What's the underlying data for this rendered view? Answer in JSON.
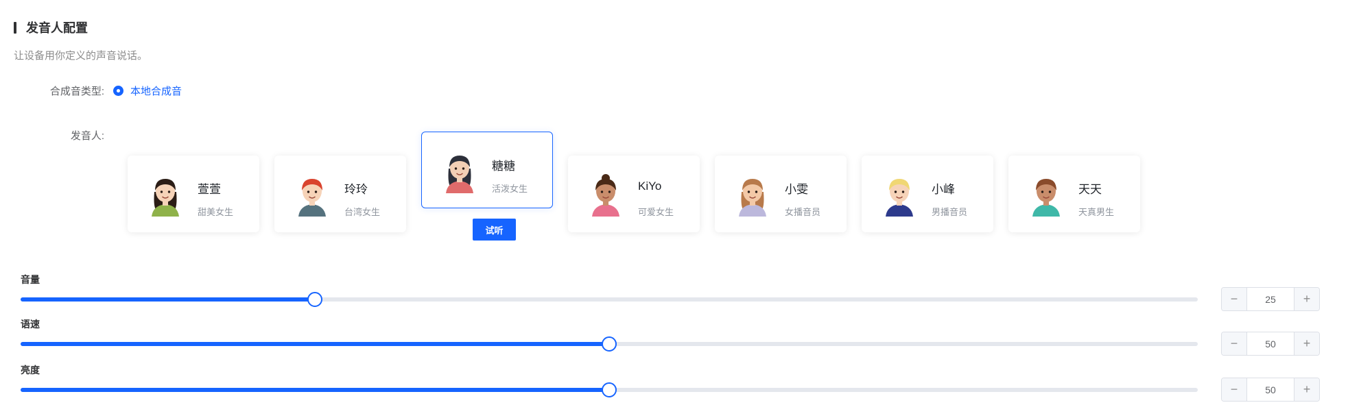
{
  "section": {
    "title": "发音人配置",
    "description": "让设备用你定义的声音说话。"
  },
  "synthesis_type": {
    "label": "合成音类型:",
    "selected_option": "本地合成音"
  },
  "speaker": {
    "label": "发音人:",
    "selected_index": 2,
    "try_button_label": "试听",
    "options": [
      {
        "name": "萱萱",
        "description": "甜美女生",
        "avatar": "avatar-girl-braid",
        "hair_color": "#2b1d16",
        "skin_color": "#f6d3b8",
        "shirt_color": "#8fb24a"
      },
      {
        "name": "玲玲",
        "description": "台湾女生",
        "avatar": "avatar-girl-red-hair",
        "hair_color": "#d9432e",
        "skin_color": "#f6d3b8",
        "shirt_color": "#55727e"
      },
      {
        "name": "糖糖",
        "description": "活泼女生",
        "avatar": "avatar-girl-long-hair",
        "hair_color": "#2c2f3a",
        "skin_color": "#f3cfb5",
        "shirt_color": "#e06b6b"
      },
      {
        "name": "KiYo",
        "description": "可爱女生",
        "avatar": "avatar-girl-bun",
        "hair_color": "#4a2a17",
        "skin_color": "#c98d6b",
        "shirt_color": "#e8708d"
      },
      {
        "name": "小雯",
        "description": "女播音员",
        "avatar": "avatar-girl-headband",
        "hair_color": "#b87a4b",
        "skin_color": "#f3c9a7",
        "shirt_color": "#bcb8dc"
      },
      {
        "name": "小峰",
        "description": "男播音员",
        "avatar": "avatar-boy-blond",
        "hair_color": "#f0d774",
        "skin_color": "#f6d3b8",
        "shirt_color": "#2d3a8c"
      },
      {
        "name": "天天",
        "description": "天真男生",
        "avatar": "avatar-boy-brown",
        "hair_color": "#8a4b2b",
        "skin_color": "#c98d6b",
        "shirt_color": "#3fb8a8"
      }
    ]
  },
  "sliders": [
    {
      "label": "音量",
      "value": "25",
      "fraction": 0.25
    },
    {
      "label": "语速",
      "value": "50",
      "fraction": 0.5
    },
    {
      "label": "亮度",
      "value": "50",
      "fraction": 0.5
    }
  ],
  "stepper_symbols": {
    "minus": "−",
    "plus": "+"
  },
  "colors": {
    "accent": "#1664ff",
    "track": "#e4e7ed"
  }
}
